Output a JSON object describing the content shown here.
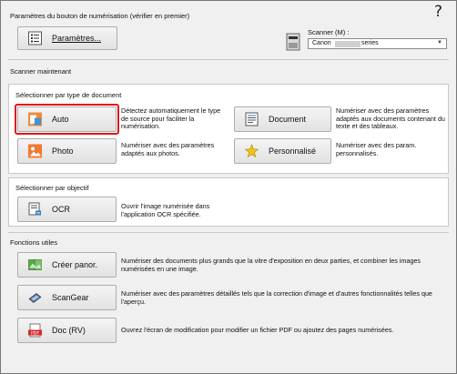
{
  "header": {
    "settings_section_title": "Paramètres du bouton de numérisation (vérifier en premier)",
    "settings_button_label": "Paramètres...",
    "help_glyph": "?",
    "scanner_label": "Scanner (M) :",
    "scanner_value_left": "Canon",
    "scanner_value_right": "series"
  },
  "scan_now": {
    "title": "Scanner maintenant",
    "by_type": {
      "title": "Sélectionner par type de document",
      "items": [
        {
          "label": "Auto",
          "desc": "Détectez automatiquement le type de source pour faciliter la numérisation.",
          "icon": "auto-scan-icon"
        },
        {
          "label": "Document",
          "desc": "Numériser avec des paramètres adaptés aux documents contenant du texte et des tableaux.",
          "icon": "document-icon"
        },
        {
          "label": "Photo",
          "desc": "Numériser avec des paramètres adaptés aux photos.",
          "icon": "photo-icon"
        },
        {
          "label": "Personnalisé",
          "desc": "Numériser avec des param. personnalisés.",
          "icon": "star-icon"
        }
      ]
    },
    "by_purpose": {
      "title": "Sélectionner par objectif",
      "items": [
        {
          "label": "OCR",
          "desc": "Ouvrir l'image numérisée dans l'application OCR spécifiée.",
          "icon": "ocr-icon"
        }
      ]
    }
  },
  "utilities": {
    "title": "Fonctions utiles",
    "items": [
      {
        "label": "Créer panor.",
        "desc": "Numériser des documents plus grands que la vitre d'exposition en deux parties, et combiner les images numérisées en une image.",
        "icon": "panorama-icon"
      },
      {
        "label": "ScanGear",
        "desc": "Numériser avec des paramètres détaillés tels que la correction d'image et d'autres fonctionnalités telles que l'aperçu.",
        "icon": "scangear-icon"
      },
      {
        "label": "Doc (RV)",
        "desc": "Ouvrez l'écran de modification pour modifier un fichier PDF ou ajoutez des pages numérisées.",
        "icon": "pdf-icon"
      }
    ]
  },
  "colors": {
    "focus_ring": "#e01818",
    "panel_bg": "#f0f0f0",
    "group_bg": "#ffffff"
  }
}
